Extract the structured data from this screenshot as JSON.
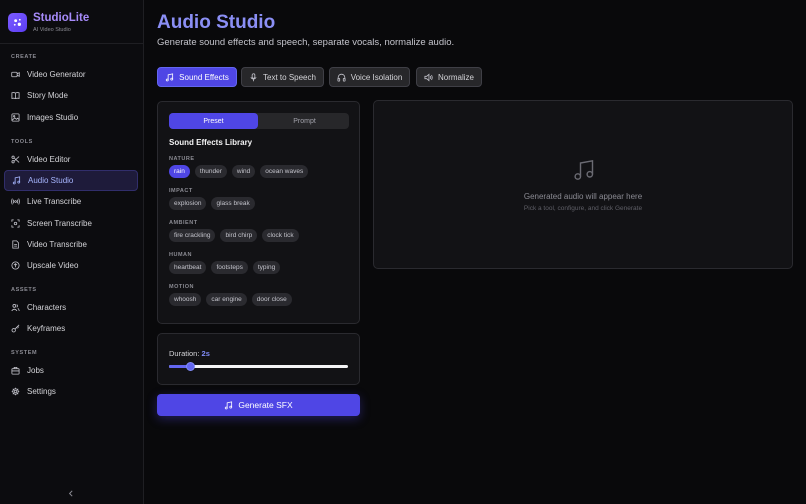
{
  "brand": {
    "name": "StudioLite",
    "subtitle": "AI Video Studio"
  },
  "sidebar": {
    "sections": [
      {
        "label": "CREATE",
        "items": [
          {
            "label": "Video Generator",
            "icon": "video-camera-icon"
          },
          {
            "label": "Story Mode",
            "icon": "book-icon"
          },
          {
            "label": "Images Studio",
            "icon": "image-icon"
          }
        ]
      },
      {
        "label": "TOOLS",
        "items": [
          {
            "label": "Video Editor",
            "icon": "scissors-icon"
          },
          {
            "label": "Audio Studio",
            "icon": "music-note-icon",
            "active": true
          },
          {
            "label": "Live Transcribe",
            "icon": "broadcast-icon"
          },
          {
            "label": "Screen Transcribe",
            "icon": "screen-capture-icon"
          },
          {
            "label": "Video Transcribe",
            "icon": "document-icon"
          },
          {
            "label": "Upscale Video",
            "icon": "upscale-circle-icon"
          }
        ]
      },
      {
        "label": "ASSETS",
        "items": [
          {
            "label": "Characters",
            "icon": "users-icon"
          },
          {
            "label": "Keyframes",
            "icon": "key-icon"
          }
        ]
      },
      {
        "label": "SYSTEM",
        "items": [
          {
            "label": "Jobs",
            "icon": "briefcase-icon"
          },
          {
            "label": "Settings",
            "icon": "gear-icon"
          }
        ]
      }
    ]
  },
  "header": {
    "title": "Audio Studio",
    "subtitle": "Generate sound effects and speech, separate vocals, normalize audio."
  },
  "tabs": [
    {
      "label": "Sound Effects",
      "icon": "music-note-icon",
      "active": true
    },
    {
      "label": "Text to Speech",
      "icon": "microphone-icon"
    },
    {
      "label": "Voice Isolation",
      "icon": "headphones-icon"
    },
    {
      "label": "Normalize",
      "icon": "speaker-icon"
    }
  ],
  "sfx": {
    "mode_preset": "Preset",
    "mode_prompt": "Prompt",
    "library_title": "Sound Effects Library",
    "categories": [
      {
        "label": "NATURE",
        "chips": [
          "rain",
          "thunder",
          "wind",
          "ocean waves"
        ],
        "selected": "rain"
      },
      {
        "label": "IMPACT",
        "chips": [
          "explosion",
          "glass break"
        ]
      },
      {
        "label": "AMBIENT",
        "chips": [
          "fire crackling",
          "bird chirp",
          "clock tick"
        ]
      },
      {
        "label": "HUMAN",
        "chips": [
          "heartbeat",
          "footsteps",
          "typing"
        ]
      },
      {
        "label": "MOTION",
        "chips": [
          "whoosh",
          "car engine",
          "door close"
        ]
      }
    ]
  },
  "duration": {
    "label": "Duration:",
    "value": "2s",
    "fraction": 0.12
  },
  "generate_label": "Generate SFX",
  "output": {
    "title": "Generated audio will appear here",
    "hint": "Pick a tool, configure, and click Generate"
  },
  "colors": {
    "accent": "#4f46e5",
    "accent_text": "#818cf8",
    "background": "#09090b",
    "panel": "#121215"
  }
}
